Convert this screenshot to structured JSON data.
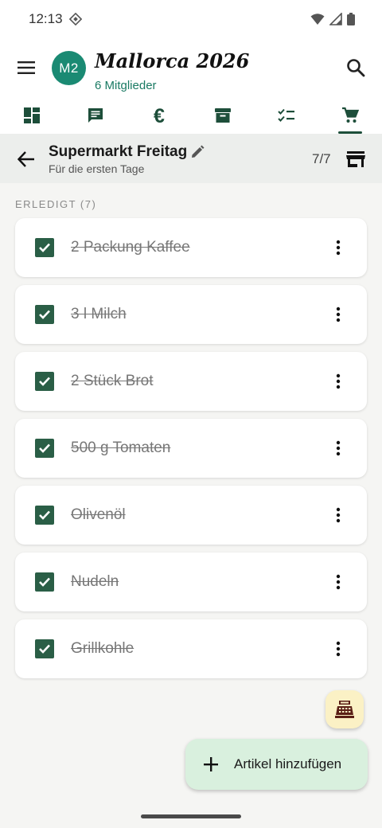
{
  "status_bar": {
    "time": "12:13"
  },
  "app_bar": {
    "avatar_initials": "M2",
    "title": "Mallorca 2026",
    "subtitle": "6 Mitglieder"
  },
  "tabs": [
    {
      "icon": "dashboard-icon",
      "active": false
    },
    {
      "icon": "chat-icon",
      "active": false
    },
    {
      "icon": "euro-icon",
      "glyph": "€",
      "active": false
    },
    {
      "icon": "archive-icon",
      "active": false
    },
    {
      "icon": "checklist-icon",
      "active": false
    },
    {
      "icon": "shopping-cart-icon",
      "active": true
    }
  ],
  "list": {
    "title": "Supermarkt Freitag",
    "subtitle": "Für die ersten Tage",
    "count": "7/7"
  },
  "section": {
    "label": "ERLEDIGT (7)"
  },
  "items": [
    {
      "label": "2 Packung Kaffee",
      "checked": true
    },
    {
      "label": "3 l Milch",
      "checked": true
    },
    {
      "label": "2 Stück Brot",
      "checked": true
    },
    {
      "label": "500 g Tomaten",
      "checked": true
    },
    {
      "label": "Olivenöl",
      "checked": true
    },
    {
      "label": "Nudeln",
      "checked": true
    },
    {
      "label": "Grillkohle",
      "checked": true
    }
  ],
  "fab": {
    "label": "Artikel hinzufügen"
  },
  "colors": {
    "primary": "#1d4e3a",
    "avatar": "#1a8a73",
    "checkbox": "#2a5e46",
    "fab_small": "#fbf1c5",
    "fab_extended": "#d9f0de"
  }
}
